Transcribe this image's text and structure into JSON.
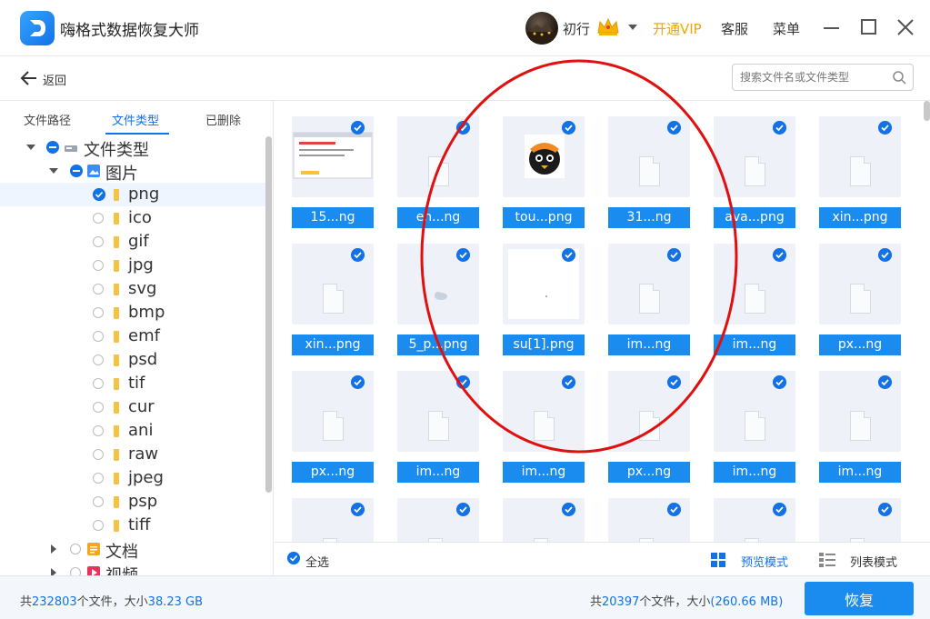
{
  "app": {
    "title": "嗨格式数据恢复大师",
    "user_name": "初行",
    "vip_label": "开通VIP",
    "service_label": "客服",
    "menu_label": "菜单"
  },
  "nav": {
    "back_label": "返回",
    "search_placeholder": "搜索文件名或文件类型"
  },
  "tabs": [
    "文件路径",
    "文件类型",
    "已删除"
  ],
  "tree": {
    "root_label": "文件类型",
    "images_label": "图片",
    "image_types": [
      "png",
      "ico",
      "gif",
      "jpg",
      "svg",
      "bmp",
      "emf",
      "psd",
      "tif",
      "cur",
      "ani",
      "raw",
      "jpeg",
      "psp",
      "tiff"
    ],
    "docs_label": "文档",
    "video_label": "视频"
  },
  "files": [
    "15...ng",
    "en...ng",
    "tou...png",
    "31...ng",
    "ava...png",
    "xin...png",
    "xin...png",
    "5_p...png",
    "su[1].png",
    "im...ng",
    "im...ng",
    "px...ng",
    "px...ng",
    "im...ng",
    "im...ng",
    "px...ng",
    "im...ng",
    "im...ng",
    "",
    "",
    "",
    "",
    "",
    ""
  ],
  "toolbar": {
    "select_all": "全选",
    "preview_mode": "预览模式",
    "list_mode": "列表模式"
  },
  "status": {
    "total_prefix": "共",
    "total_count": "232803",
    "total_mid": "个文件，大小",
    "total_size": "38.23 GB",
    "sel_prefix": "共",
    "sel_count": "20397",
    "sel_mid": "个文件，大小",
    "sel_size": "(260.66 MB)",
    "recover_label": "恢复"
  },
  "colors": {
    "accent": "#1a8cf0",
    "vip": "#f0a500",
    "annotation": "#e01010"
  }
}
